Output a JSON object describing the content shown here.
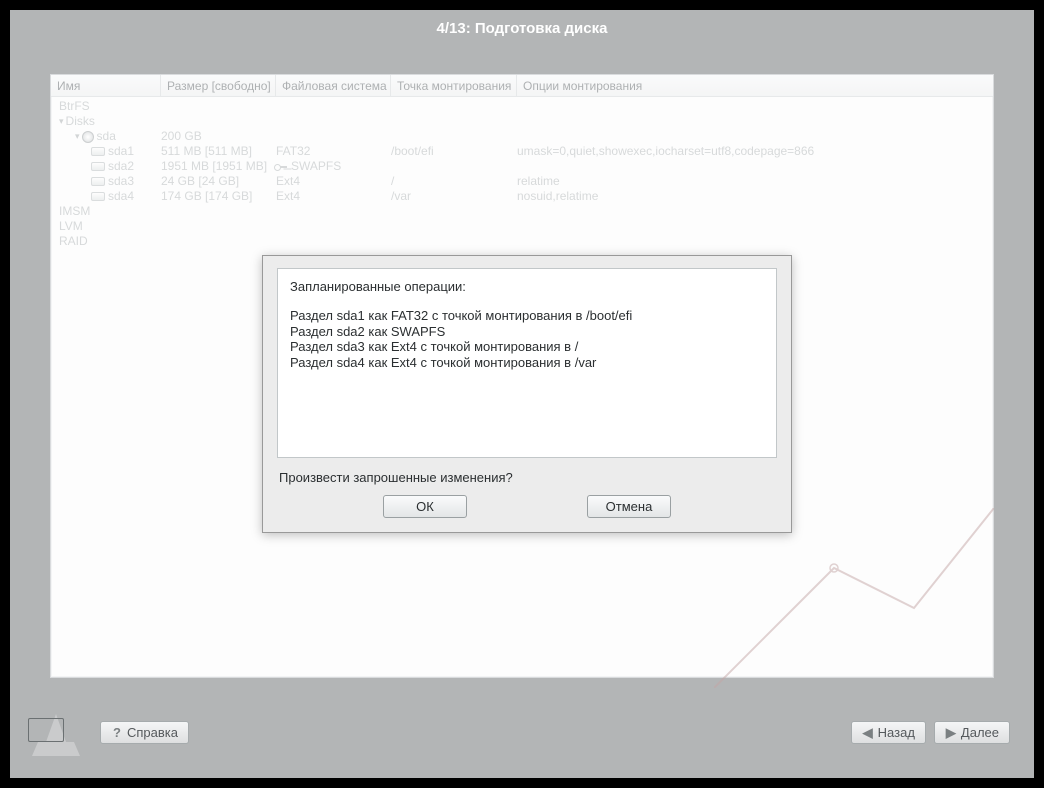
{
  "header": {
    "title": "4/13: Подготовка диска"
  },
  "columns": {
    "name": "Имя",
    "size": "Размер [свободно]",
    "fs": "Файловая система",
    "mount": "Точка монтирования",
    "opts": "Опции монтирования"
  },
  "tree": {
    "btrfs": "BtrFS",
    "disks": "Disks",
    "sda": {
      "name": "sda",
      "size": "200 GB"
    },
    "partitions": [
      {
        "name": "sda1",
        "size": "511 MB [511 MB]",
        "fs": "FAT32",
        "mount": "/boot/efi",
        "opts": "umask=0,quiet,showexec,iocharset=utf8,codepage=866",
        "key": false
      },
      {
        "name": "sda2",
        "size": "1951 MB [1951 MB]",
        "fs": "SWAPFS",
        "mount": "",
        "opts": "",
        "key": true
      },
      {
        "name": "sda3",
        "size": "24 GB [24 GB]",
        "fs": "Ext4",
        "mount": "/",
        "opts": "relatime",
        "key": false
      },
      {
        "name": "sda4",
        "size": "174 GB [174 GB]",
        "fs": "Ext4",
        "mount": "/var",
        "opts": "nosuid,relatime",
        "key": false
      }
    ],
    "imsm": "IMSM",
    "lvm": "LVM",
    "raid": "RAID"
  },
  "dialog": {
    "heading": "Запланированные операции:",
    "lines": [
      "Раздел sda1 как FAT32 с точкой монтирования в /boot/efi",
      "Раздел sda2 как SWAPFS",
      "Раздел sda3 как Ext4 с точкой монтирования в /",
      "Раздел sda4 как Ext4 с точкой монтирования в /var"
    ],
    "question": "Произвести запрошенные изменения?",
    "ok": "ОК",
    "cancel": "Отмена"
  },
  "footer": {
    "help": "Справка",
    "back": "Назад",
    "next": "Далее"
  }
}
